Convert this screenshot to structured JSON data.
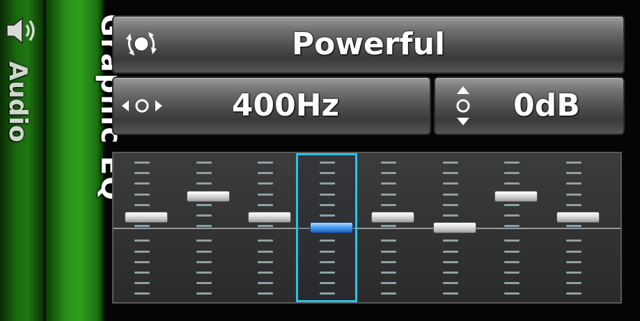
{
  "tabs": {
    "audio": {
      "label": "Audio",
      "icon": "speaker-icon"
    },
    "graphic_eq": {
      "label": "Graphic EQ"
    }
  },
  "mode": {
    "label": "Powerful",
    "icon": "preset-select-icon"
  },
  "frequency": {
    "label": "400Hz",
    "icon": "left-right-arrows-icon"
  },
  "gain": {
    "label": "0dB",
    "icon": "up-down-arrows-icon"
  },
  "equalizer": {
    "selected_index": 3,
    "range": [
      -6,
      6
    ],
    "bands": [
      {
        "level": 1
      },
      {
        "level": 3
      },
      {
        "level": 1
      },
      {
        "level": 0
      },
      {
        "level": 1
      },
      {
        "level": 0
      },
      {
        "level": 3
      },
      {
        "level": 1
      }
    ]
  },
  "colors": {
    "tab_green": "#2a8e18",
    "selection": "#27c6e8",
    "selected_knob": "#4fa0f0"
  }
}
